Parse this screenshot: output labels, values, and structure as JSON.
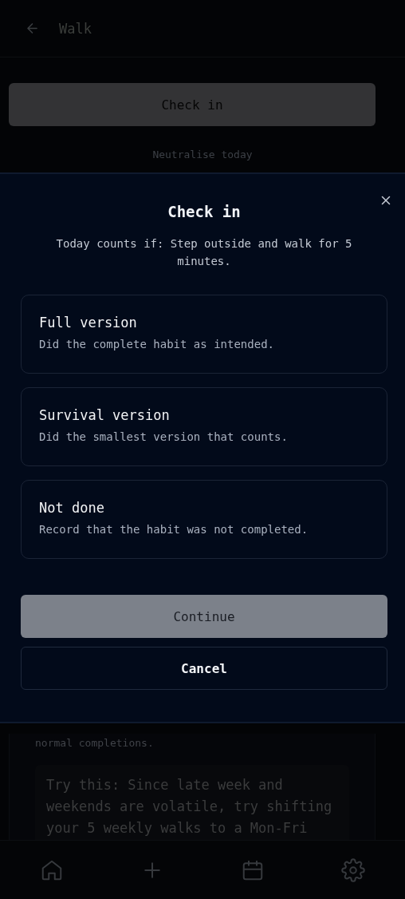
{
  "header": {
    "title": "Walk"
  },
  "page": {
    "check_in_button": "Check in",
    "neutralise_link": "Neutralise today",
    "note": "normal completions.",
    "tip": "Try this: Since late week and weekends are volatile, try shifting your 5 weekly walks to a Mon-Fri"
  },
  "sheet": {
    "title": "Check in",
    "subtitle": "Today counts if: Step outside and walk for 5 minutes.",
    "options": [
      {
        "title": "Full version",
        "description": "Did the complete habit as intended.",
        "selected": false
      },
      {
        "title": "Survival version",
        "description": "Did the smallest version that counts.",
        "selected": false
      },
      {
        "title": "Not done",
        "description": "Record that the habit was not completed.",
        "selected": false
      }
    ],
    "continue_button": {
      "label": "Continue",
      "disabled": true
    },
    "cancel_button": "Cancel"
  },
  "nav": [
    {
      "kind": "home"
    },
    {
      "kind": "add"
    },
    {
      "kind": "calendar"
    },
    {
      "kind": "settings"
    }
  ]
}
